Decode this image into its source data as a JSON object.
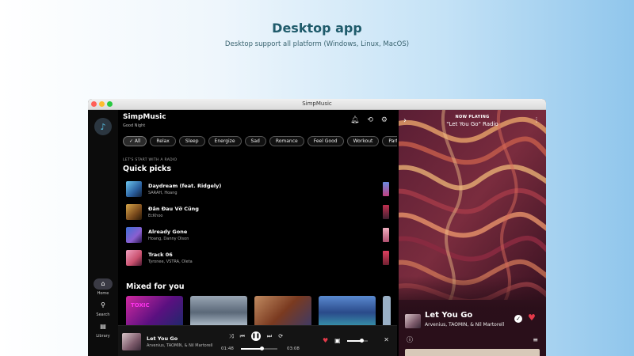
{
  "page": {
    "headline": "Desktop app",
    "subline": "Desktop support all platform (Windows, Linux, MacOS)"
  },
  "window": {
    "title": "SimpMusic"
  },
  "nav": [
    {
      "label": "Home",
      "icon": "home-icon",
      "active": true
    },
    {
      "label": "Search",
      "icon": "search-icon",
      "active": false
    },
    {
      "label": "Library",
      "icon": "library-icon",
      "active": false
    }
  ],
  "header": {
    "app_name": "SimpMusic",
    "greeting": "Good Night",
    "icons": [
      "bell-icon",
      "history-icon",
      "gear-icon"
    ]
  },
  "chips": [
    {
      "label": "✓  All",
      "selected": true
    },
    {
      "label": "Relax",
      "selected": false
    },
    {
      "label": "Sleep",
      "selected": false
    },
    {
      "label": "Energize",
      "selected": false
    },
    {
      "label": "Sad",
      "selected": false
    },
    {
      "label": "Romance",
      "selected": false
    },
    {
      "label": "Feel Good",
      "selected": false
    },
    {
      "label": "Workout",
      "selected": false
    },
    {
      "label": "Party",
      "selected": false
    }
  ],
  "quick_picks": {
    "subtitle": "LET'S START WITH A RADIO",
    "title": "Quick picks",
    "tracks": [
      {
        "title": "Daydream (feat. Ridgely)",
        "artist": "SARAH, Hoang"
      },
      {
        "title": "Đân Đau Vỡ Cũng",
        "artist": "EcKhoo"
      },
      {
        "title": "Already Gone",
        "artist": "Hoang, Danny Olson"
      },
      {
        "title": "Track 06",
        "artist": "Tyronee, VSTRA, Oleta"
      }
    ]
  },
  "mixed": {
    "title": "Mixed for you",
    "cards": [
      {
        "tag": "TOXIC"
      },
      {
        "tag": ""
      },
      {
        "tag": ""
      },
      {
        "tag": ""
      }
    ]
  },
  "player": {
    "title": "Let You Go",
    "artist": "Arvenius, TAOMIN, & Nil Martorell",
    "elapsed": "01:48",
    "duration": "03:08",
    "progress": 0.57,
    "volume": 0.72,
    "controls": [
      "shuffle-icon",
      "previous-icon",
      "pause-icon",
      "next-icon",
      "repeat-icon"
    ]
  },
  "now_playing": {
    "label": "NOW PLAYING",
    "radio": "\"Let You Go\" Radio",
    "title": "Let You Go",
    "artist": "Arvenius, TAOMIN, & Nil Martorell"
  },
  "colors": {
    "accent": "#e53a4a",
    "headline": "#1f5b6b",
    "logo": "#59c3e6"
  }
}
